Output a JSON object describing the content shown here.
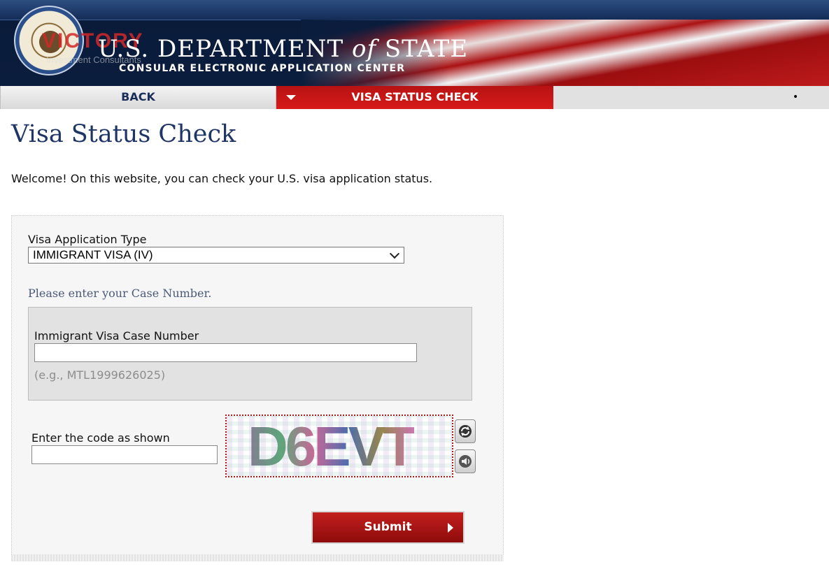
{
  "header": {
    "department_title_part1": "U.S. DEPARTMENT",
    "department_title_of": "of",
    "department_title_part2": "STATE",
    "department_subtitle": "CONSULAR ELECTRONIC APPLICATION CENTER",
    "watermark_brand": "VICTORY",
    "watermark_tagline": "Investment Consultants",
    "seal_icon": "us-department-of-state-seal-icon"
  },
  "nav": {
    "back_label": "BACK",
    "active_label": "VISA STATUS CHECK",
    "dot": "•"
  },
  "page": {
    "title": "Visa Status Check",
    "welcome": "Welcome! On this website, you can check your U.S. visa application status."
  },
  "form": {
    "application_type_label": "Visa Application Type",
    "application_type_selected": "IMMIGRANT VISA (IV)",
    "case_hint": "Please enter your Case Number.",
    "case_number_label": "Immigrant Visa Case Number",
    "case_number_value": "",
    "case_number_example": "(e.g., MTL1999626025)",
    "code_label": "Enter the code as shown",
    "code_value": "",
    "captcha_text": "D6EVT",
    "refresh_icon": "refresh-icon",
    "audio_icon": "speaker-icon",
    "submit_label": "Submit"
  },
  "colors": {
    "nav_active": "#c61818",
    "title_blue": "#1f3566",
    "submit_red": "#a81414"
  }
}
